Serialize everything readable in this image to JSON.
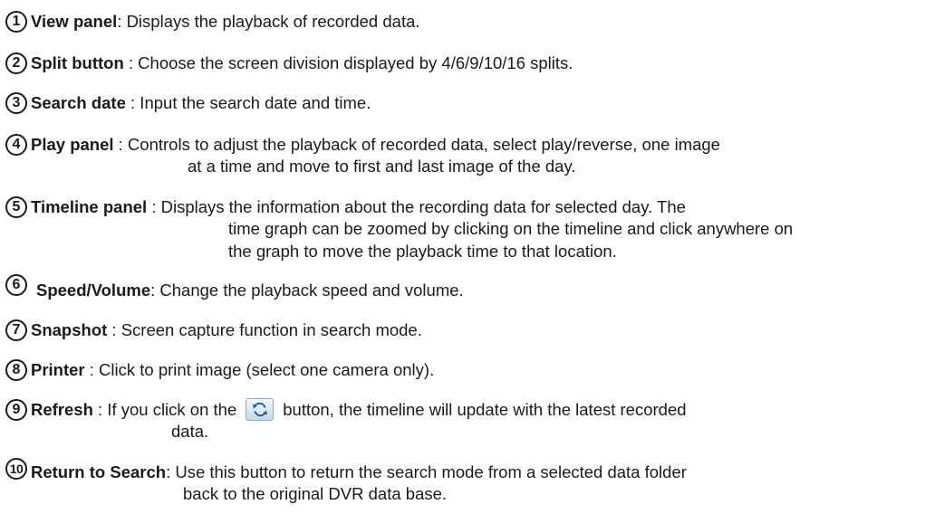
{
  "items": [
    {
      "num": "1",
      "term": "View panel",
      "lines": [
        ": Displays the playback of recorded data."
      ]
    },
    {
      "num": "2",
      "term": "Split button",
      "lines": [
        " : Choose the screen division displayed by 4/6/9/10/16 splits."
      ]
    },
    {
      "num": "3",
      "term": "Search date",
      "lines": [
        " : Input the search date and time."
      ]
    },
    {
      "num": "4",
      "term": "Play panel",
      "lines": [
        " : Controls to adjust the playback of recorded data, select play/reverse, one image",
        "at a time and move to first and last image of the day."
      ]
    },
    {
      "num": "5",
      "term": "Timeline panel",
      "lines": [
        " : Displays the information about the recording data for selected day. The",
        "time graph can be zoomed by clicking on the timeline and click anywhere on",
        "the graph to move the playback time to that location."
      ]
    },
    {
      "num": "6",
      "term": "Speed/Volume",
      "lines": [
        ": Change the playback speed and volume."
      ]
    },
    {
      "num": "7",
      "term": "Snapshot",
      "lines": [
        " : Screen capture function in search mode."
      ]
    },
    {
      "num": "8",
      "term": "Printer",
      "lines": [
        " : Click to print image (select one camera only)."
      ]
    },
    {
      "num": "9",
      "term": "Refresh",
      "line1_before": " : If you click on the",
      "line1_after": "button, the timeline will update with the latest recorded",
      "lines": [
        "",
        "data."
      ]
    },
    {
      "num": "10",
      "term": "Return to Search",
      "lines": [
        ": Use this button to return the search mode from a selected data folder",
        "back to the original DVR data base."
      ]
    }
  ],
  "refresh_icon": "refresh-icon"
}
